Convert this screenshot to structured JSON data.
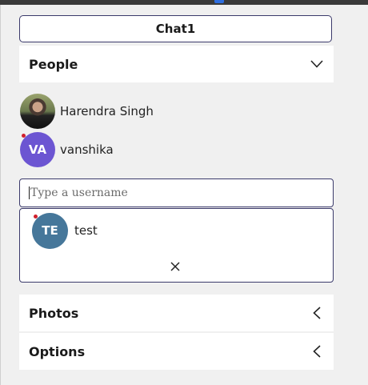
{
  "chat": {
    "title": "Chat1"
  },
  "people": {
    "label": "People",
    "members": [
      {
        "name": "Harendra Singh",
        "initials": "",
        "status_color": "#22a63a",
        "avatar_type": "photo"
      },
      {
        "name": "vanshika",
        "initials": "VA",
        "status_color": "#d0202c",
        "avatar_color": "#6c55d2"
      }
    ]
  },
  "search": {
    "placeholder": "Type a username",
    "results": [
      {
        "name": "test",
        "initials": "TE",
        "status_color": "#d0202c",
        "avatar_color": "#46779a"
      }
    ],
    "close_icon": "close-icon"
  },
  "photos": {
    "label": "Photos",
    "icon": "chevron-left-icon"
  },
  "options": {
    "label": "Options",
    "icon": "chevron-left-icon"
  },
  "people_icon": "chevron-down-icon"
}
